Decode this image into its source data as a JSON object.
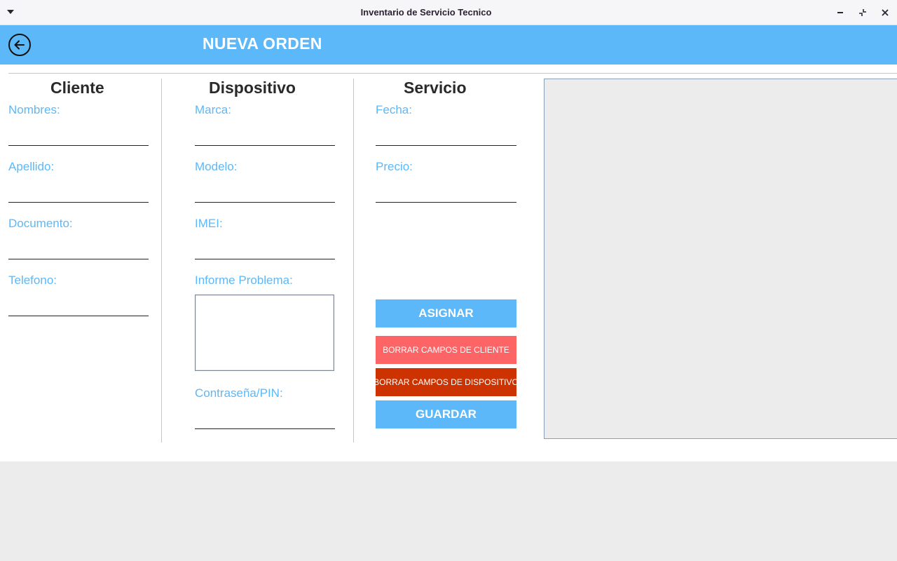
{
  "window": {
    "title": "Inventario de Servicio Tecnico",
    "controls": {
      "minimize": "−",
      "maximize": "⤡",
      "close": "✕"
    }
  },
  "header": {
    "title": "NUEVA ORDEN",
    "back_icon": "arrow-left-circle-icon"
  },
  "cliente": {
    "title": "Cliente",
    "fields": [
      {
        "label": "Nombres:",
        "value": ""
      },
      {
        "label": "Apellido:",
        "value": ""
      },
      {
        "label": "Documento:",
        "value": ""
      },
      {
        "label": "Telefono:",
        "value": ""
      }
    ]
  },
  "dispositivo": {
    "title": "Dispositivo",
    "fields": [
      {
        "label": "Marca:",
        "value": ""
      },
      {
        "label": "Modelo:",
        "value": ""
      },
      {
        "label": "IMEI:",
        "value": ""
      },
      {
        "label": "Informe Problema:",
        "value": ""
      },
      {
        "label": "Contraseña/PIN:",
        "value": ""
      }
    ]
  },
  "servicio": {
    "title": "Servicio",
    "fields": [
      {
        "label": "Fecha:",
        "value": ""
      },
      {
        "label": "Precio:",
        "value": ""
      }
    ],
    "buttons": {
      "asignar": "ASIGNAR",
      "borrar_cliente": "BORRAR CAMPOS DE CLIENTE",
      "borrar_dispositivo": "BORRAR CAMPOS DE DISPOSITIVO",
      "guardar": "GUARDAR"
    }
  },
  "colors": {
    "accent": "#5cb8f9",
    "danger_light": "#fc6466",
    "danger_dark": "#cc3300",
    "panel_bg": "#ececec"
  }
}
